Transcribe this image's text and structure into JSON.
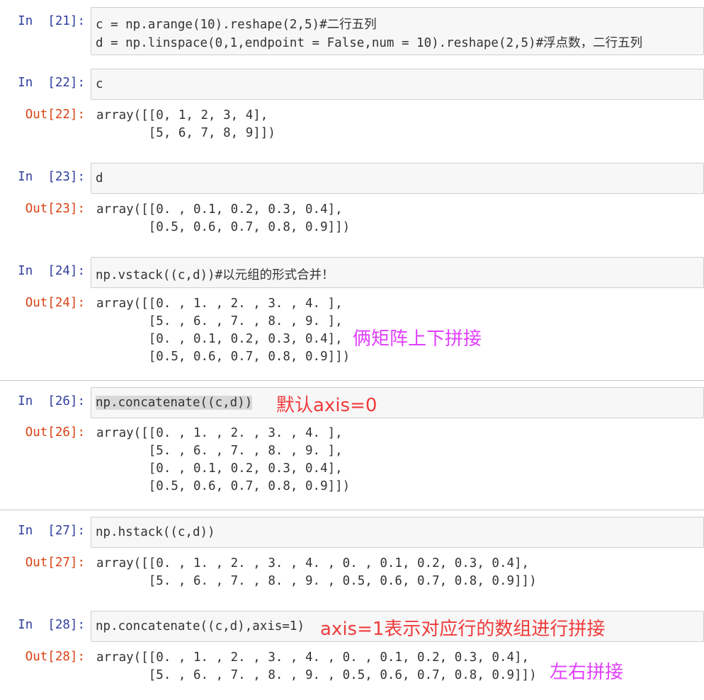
{
  "cells": [
    {
      "in_prompt": "In  [21]:",
      "code": [
        "c = np.arange(10).reshape(2,5)#二行五列",
        "d = np.linspace(0,1,endpoint = False,num = 10).reshape(2,5)#浮点数，二行五列"
      ]
    },
    {
      "in_prompt": "In  [22]:",
      "code": [
        "c"
      ],
      "out_prompt": "Out[22]:",
      "output": [
        "array([[0, 1, 2, 3, 4],",
        "       [5, 6, 7, 8, 9]])"
      ]
    },
    {
      "in_prompt": "In  [23]:",
      "code": [
        "d"
      ],
      "out_prompt": "Out[23]:",
      "output": [
        "array([[0. , 0.1, 0.2, 0.3, 0.4],",
        "       [0.5, 0.6, 0.7, 0.8, 0.9]])"
      ]
    },
    {
      "in_prompt": "In  [24]:",
      "code": [
        "np.vstack((c,d))#以元组的形式合并！"
      ],
      "out_prompt": "Out[24]:",
      "output": [
        "array([[0. , 1. , 2. , 3. , 4. ],",
        "       [5. , 6. , 7. , 8. , 9. ],",
        "       [0. , 0.1, 0.2, 0.3, 0.4],",
        "       [0.5, 0.6, 0.7, 0.8, 0.9]])"
      ]
    },
    {
      "in_prompt": "In  [26]:",
      "code": [
        "np.concatenate((c,d))"
      ],
      "out_prompt": "Out[26]:",
      "output": [
        "array([[0. , 1. , 2. , 3. , 4. ],",
        "       [5. , 6. , 7. , 8. , 9. ],",
        "       [0. , 0.1, 0.2, 0.3, 0.4],",
        "       [0.5, 0.6, 0.7, 0.8, 0.9]])"
      ]
    },
    {
      "in_prompt": "In  [27]:",
      "code": [
        "np.hstack((c,d))"
      ],
      "out_prompt": "Out[27]:",
      "output": [
        "array([[0. , 1. , 2. , 3. , 4. , 0. , 0.1, 0.2, 0.3, 0.4],",
        "       [5. , 6. , 7. , 8. , 9. , 0.5, 0.6, 0.7, 0.8, 0.9]])"
      ]
    },
    {
      "in_prompt": "In  [28]:",
      "code": [
        "np.concatenate((c,d),axis=1)"
      ],
      "out_prompt": "Out[28]:",
      "output": [
        "array([[0. , 1. , 2. , 3. , 4. , 0. , 0.1, 0.2, 0.3, 0.4],",
        "       [5. , 6. , 7. , 8. , 9. , 0.5, 0.6, 0.7, 0.8, 0.9]])"
      ]
    }
  ],
  "annotations": {
    "vstack_note": "俩矩阵上下拼接",
    "concat_default_note": "默认axis=0",
    "concat_axis1_note": "axis=1表示对应行的数组进行拼接",
    "left_right_note": "左右拼接"
  },
  "colors": {
    "in_prompt": "#303f9f",
    "out_prompt": "#d84315",
    "annotation_magenta": "#e040fb",
    "annotation_red": "#ef3b3b",
    "comment": "#408080",
    "number": "#008000"
  }
}
